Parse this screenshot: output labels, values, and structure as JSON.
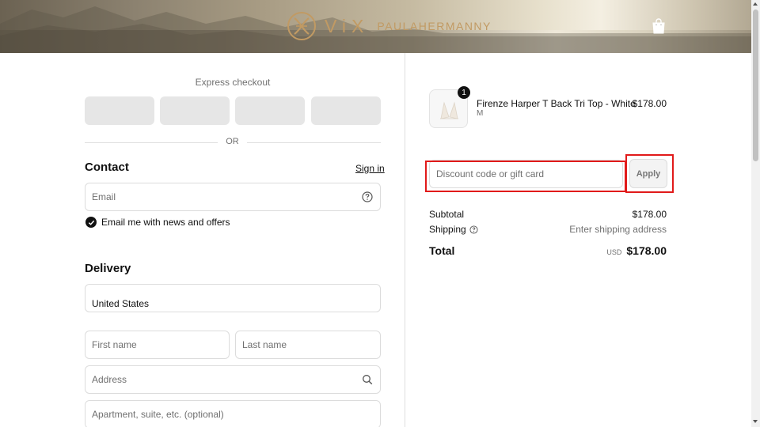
{
  "header": {
    "brand_vix": "ViX",
    "brand_name": "PAULAHERMANNY",
    "icons": {
      "logo": "vix-monogram-icon",
      "cart": "shopping-bag-icon"
    }
  },
  "express": {
    "title": "Express checkout",
    "buttons": [
      "",
      "",
      "",
      ""
    ],
    "or_label": "OR"
  },
  "contact": {
    "heading": "Contact",
    "signin_label": "Sign in",
    "email_placeholder": "Email",
    "news_checkbox_label": "Email me with news and offers",
    "news_checked": true
  },
  "delivery": {
    "heading": "Delivery",
    "country_value": "United States",
    "first_name_placeholder": "First name",
    "last_name_placeholder": "Last name",
    "address_placeholder": "Address",
    "apartment_placeholder": "Apartment, suite, etc. (optional)"
  },
  "order": {
    "item": {
      "quantity": "1",
      "name": "Firenze Harper T Back Tri Top - White",
      "variant": "M",
      "price": "$178.00"
    },
    "discount_placeholder": "Discount code or gift card",
    "apply_label": "Apply",
    "subtotal_label": "Subtotal",
    "subtotal_value": "$178.00",
    "shipping_label": "Shipping",
    "shipping_value": "Enter shipping address",
    "total_label": "Total",
    "currency": "USD",
    "total_value": "$178.00"
  },
  "colors": {
    "highlight": "#e11a1a",
    "brand_gold": "#c19a63",
    "text": "#111111",
    "muted": "#707070"
  }
}
